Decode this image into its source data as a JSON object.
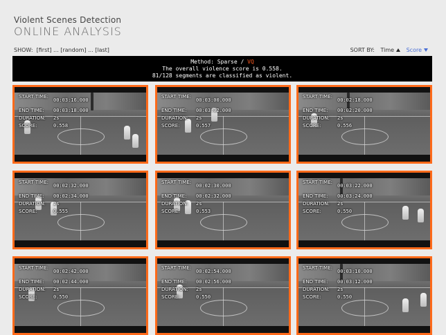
{
  "app": {
    "title": "Violent Scenes Detection",
    "subtitle": "ONLINE ANALYSIS"
  },
  "controls": {
    "show_label": "SHOW:",
    "show_first": "[first]",
    "sep1": "...",
    "show_random": "[random]",
    "sep2": "...",
    "show_last": "[last]",
    "sort_label": "SORT BY:",
    "sort_time": "Time",
    "sort_score": "Score"
  },
  "summary": {
    "method_prefix": "Method: Sparse / ",
    "method_vq": "VQ",
    "line2": "The overall violence score is 0.558.",
    "line3": "81/128 segments are classified as violent."
  },
  "labels": {
    "start_time": "START TIME:",
    "end_time": "END TIME:",
    "duration": "DURATION:",
    "score": "SCORE:"
  },
  "segments": [
    {
      "start": "00:03:16.000",
      "end": "00:03:18.000",
      "duration": "2s",
      "score": "0.558"
    },
    {
      "start": "00:03:00.000",
      "end": "00:03:02.000",
      "duration": "2s",
      "score": "0.557"
    },
    {
      "start": "00:02:18.000",
      "end": "00:02:20.000",
      "duration": "2s",
      "score": "0.556"
    },
    {
      "start": "00:02:32.000",
      "end": "00:02:34.000",
      "duration": "2s",
      "score": "0.555"
    },
    {
      "start": "00:02:30.000",
      "end": "00:02:32.000",
      "duration": "2s",
      "score": "0.553"
    },
    {
      "start": "00:03:22.000",
      "end": "00:03:24.000",
      "duration": "2s",
      "score": "0.550"
    },
    {
      "start": "00:02:42.000",
      "end": "00:02:44.000",
      "duration": "2s",
      "score": "0.550"
    },
    {
      "start": "00:02:54.000",
      "end": "00:02:56.000",
      "duration": "2s",
      "score": "0.550"
    },
    {
      "start": "00:03:10.000",
      "end": "00:03:12.000",
      "duration": "2s",
      "score": "0.550"
    }
  ],
  "colors": {
    "accent": "#ff6a1a",
    "vq": "#ff5a1f",
    "sort_active": "#4a6fd6",
    "banner_bg": "#000000"
  }
}
